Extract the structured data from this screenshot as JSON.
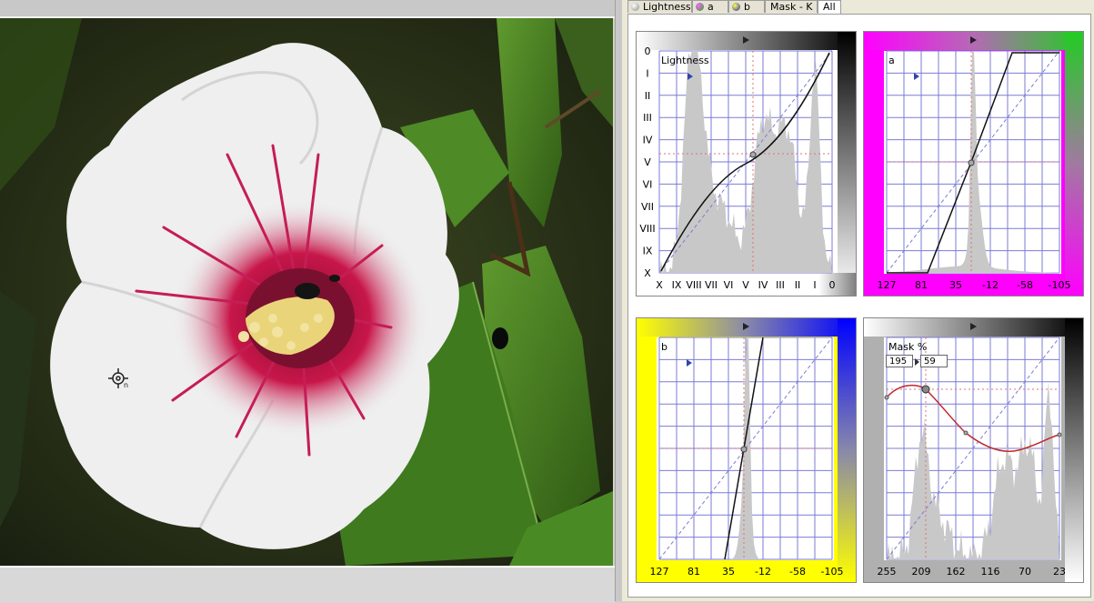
{
  "tabs": [
    {
      "label": "Lightness",
      "active": false
    },
    {
      "label": "a",
      "active": false
    },
    {
      "label": "b",
      "active": false
    },
    {
      "label": "Mask - K",
      "active": false
    },
    {
      "label": "All",
      "active": true
    }
  ],
  "cursor_label": "n",
  "panels": {
    "lightness": {
      "title": "Lightness",
      "y_labels": [
        "0",
        "I",
        "II",
        "III",
        "IV",
        "V",
        "VI",
        "VII",
        "VIII",
        "IX",
        "X"
      ],
      "x_labels": [
        "X",
        "IX",
        "VIII",
        "VII",
        "VI",
        "V",
        "IV",
        "III",
        "II",
        "I",
        "0"
      ]
    },
    "a": {
      "title": "a",
      "x_labels": [
        "127",
        "81",
        "35",
        "-12",
        "-58",
        "-105"
      ]
    },
    "b": {
      "title": "b",
      "x_labels": [
        "127",
        "81",
        "35",
        "-12",
        "-58",
        "-105"
      ]
    },
    "mask": {
      "title": "Mask %",
      "input_value": "195",
      "output_value": "59",
      "x_labels": [
        "255",
        "209",
        "162",
        "116",
        "70",
        "23"
      ]
    }
  },
  "colors": {
    "grid": "#7b7bd6",
    "histogram": "#c8c8c8",
    "mask_curve": "#c0282c",
    "magenta": "#ff00ff",
    "green": "#22cc22",
    "yellow": "#ffff00",
    "blue": "#0000ff"
  }
}
